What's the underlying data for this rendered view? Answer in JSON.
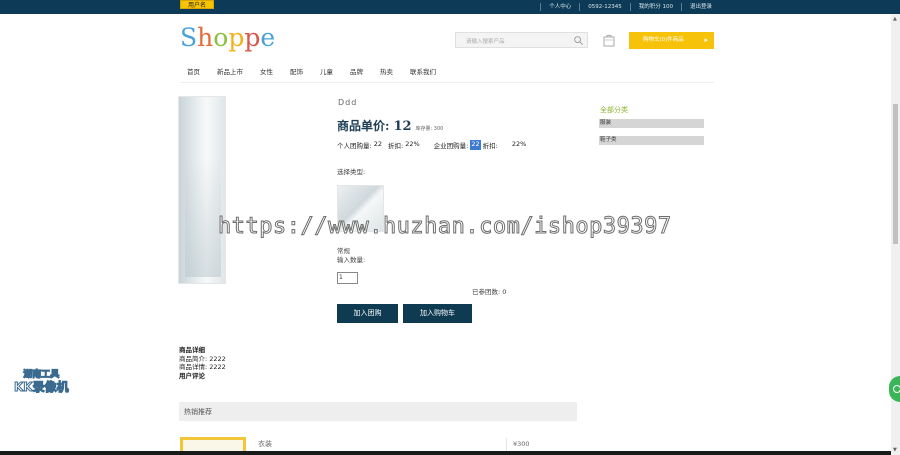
{
  "topbar": {
    "yellow_button": "用户名",
    "links": [
      "个人中心",
      "0592-12345",
      "我的积分 100",
      "退出登录"
    ]
  },
  "logo": {
    "letters": [
      "S",
      "h",
      "o",
      "p",
      "p",
      "e"
    ],
    "colors": [
      "#4aa3d8",
      "#e86a3a",
      "#8cbf3f",
      "#f2b21b",
      "#d9584a",
      "#4aa3d8"
    ]
  },
  "search": {
    "placeholder": "请输入搜索产品"
  },
  "cart_button": {
    "label": "购物车(0)件商品",
    "arrow": "▸"
  },
  "nav": [
    "首页",
    "新品上市",
    "女性",
    "配饰",
    "儿童",
    "品牌",
    "热卖",
    "联系我们"
  ],
  "product": {
    "name": "Ddd",
    "price_label": "商品单价:",
    "price_value": "12",
    "stock": "库存量: 300",
    "group": {
      "personal_label": "个人团购量:",
      "personal_value": "22",
      "personal_discount_label": "折扣:",
      "personal_discount_value": "22%",
      "enterprise_label": "企业团购量:",
      "enterprise_value": "22",
      "enterprise_discount_label": "折扣:",
      "enterprise_discount_value": "22%"
    },
    "choose_type_label": "选择类型:",
    "type_name": "常规",
    "quantity_label": "输入数量:",
    "quantity_value": "1",
    "joined_label": "已参团数: 0",
    "join_button": "加入团购",
    "cart_button": "加入购物车"
  },
  "sidebar": {
    "title": "全部分类",
    "items": [
      "服装",
      "鞋子类"
    ]
  },
  "details": {
    "title": "商品详细",
    "intro": "商品简介: 2222",
    "detail": "商品详情: 2222",
    "comments": "用户评论"
  },
  "hot": {
    "title": "热销推荐",
    "item_name": "衣装",
    "item_price": "¥300"
  },
  "watermark": "https://www.huzhan.com/ishop39397",
  "overlay_badge": {
    "line1": "湖南工具",
    "line2": "KK录像机"
  },
  "colors": {
    "topbar": "#0d3b57",
    "accent_yellow": "#f6c20a",
    "dark_button": "#0e3a52",
    "sidebar_title": "#8ab22c"
  }
}
